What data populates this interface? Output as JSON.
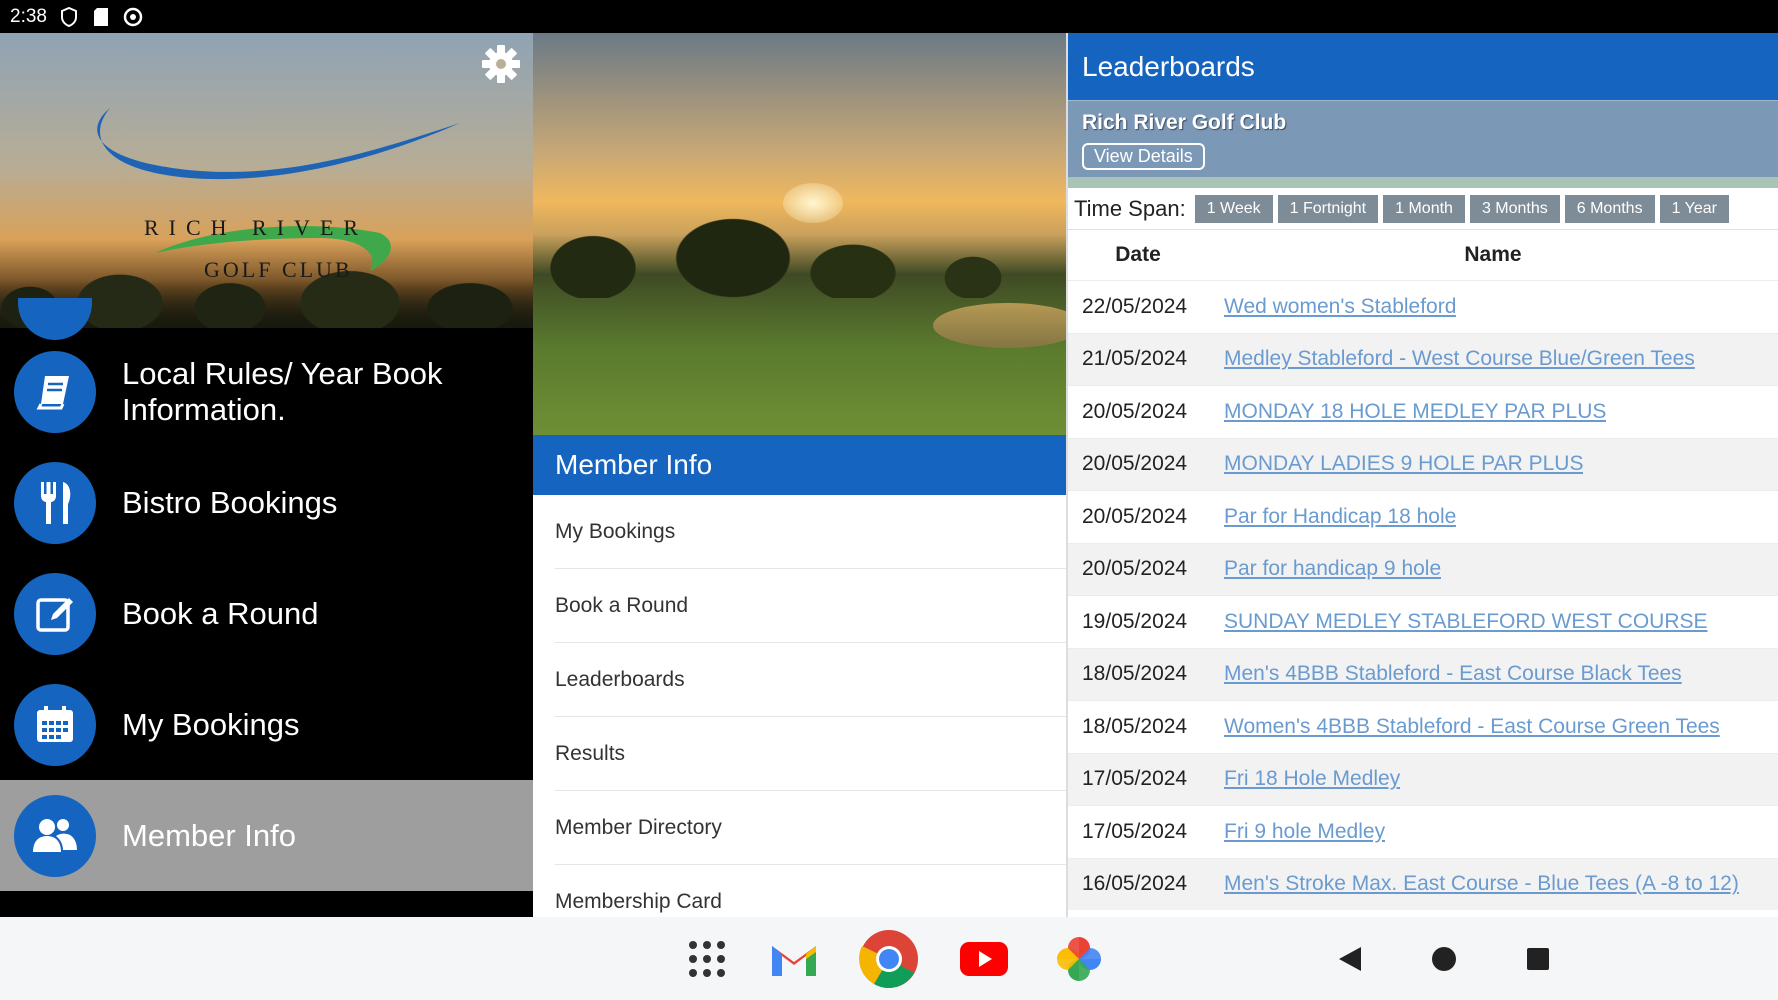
{
  "status_bar": {
    "time": "2:38"
  },
  "drawer": {
    "logo_top": "RICH RIVER",
    "logo_bottom": "GOLF CLUB",
    "items": [
      {
        "label": "Local Rules/ Year Book Information.",
        "icon": "book-icon"
      },
      {
        "label": "Bistro Bookings",
        "icon": "fork-knife-icon"
      },
      {
        "label": "Book a Round",
        "icon": "edit-icon"
      },
      {
        "label": "My Bookings",
        "icon": "calendar-icon"
      },
      {
        "label": "Member Info",
        "icon": "users-icon",
        "active": true
      }
    ]
  },
  "middle": {
    "title": "Member Info",
    "items": [
      "My Bookings",
      "Book a Round",
      "Leaderboards",
      "Results",
      "Member Directory",
      "Membership Card"
    ]
  },
  "leaderboards": {
    "title": "Leaderboards",
    "club_name": "Rich River Golf Club",
    "view_details": "View Details",
    "time_span_label": "Time Span:",
    "time_spans": [
      "1 Week",
      "1 Fortnight",
      "1 Month",
      "3 Months",
      "6 Months",
      "1 Year"
    ],
    "columns": {
      "date": "Date",
      "name": "Name"
    },
    "rows": [
      {
        "date": "22/05/2024",
        "name": "Wed women's Stableford"
      },
      {
        "date": "21/05/2024",
        "name": "Medley Stableford - West Course Blue/Green Tees"
      },
      {
        "date": "20/05/2024",
        "name": "MONDAY 18 HOLE MEDLEY PAR PLUS"
      },
      {
        "date": "20/05/2024",
        "name": "MONDAY LADIES 9 HOLE PAR PLUS"
      },
      {
        "date": "20/05/2024",
        "name": "Par for Handicap 18 hole"
      },
      {
        "date": "20/05/2024",
        "name": "Par for handicap 9 hole"
      },
      {
        "date": "19/05/2024",
        "name": "SUNDAY MEDLEY STABLEFORD WEST COURSE"
      },
      {
        "date": "18/05/2024",
        "name": "Men's 4BBB Stableford - East Course Black Tees"
      },
      {
        "date": "18/05/2024",
        "name": "Women's 4BBB Stableford - East Course Green Tees"
      },
      {
        "date": "17/05/2024",
        "name": "Fri 18 Hole Medley"
      },
      {
        "date": "17/05/2024",
        "name": "Fri 9 hole Medley"
      },
      {
        "date": "16/05/2024",
        "name": "Men's Stroke Max. East Course - Blue Tees (A -8 to 12)"
      }
    ]
  },
  "colors": {
    "primary": "#1565c0",
    "link": "#6a9bd0",
    "active_item": "#9e9e9e"
  }
}
